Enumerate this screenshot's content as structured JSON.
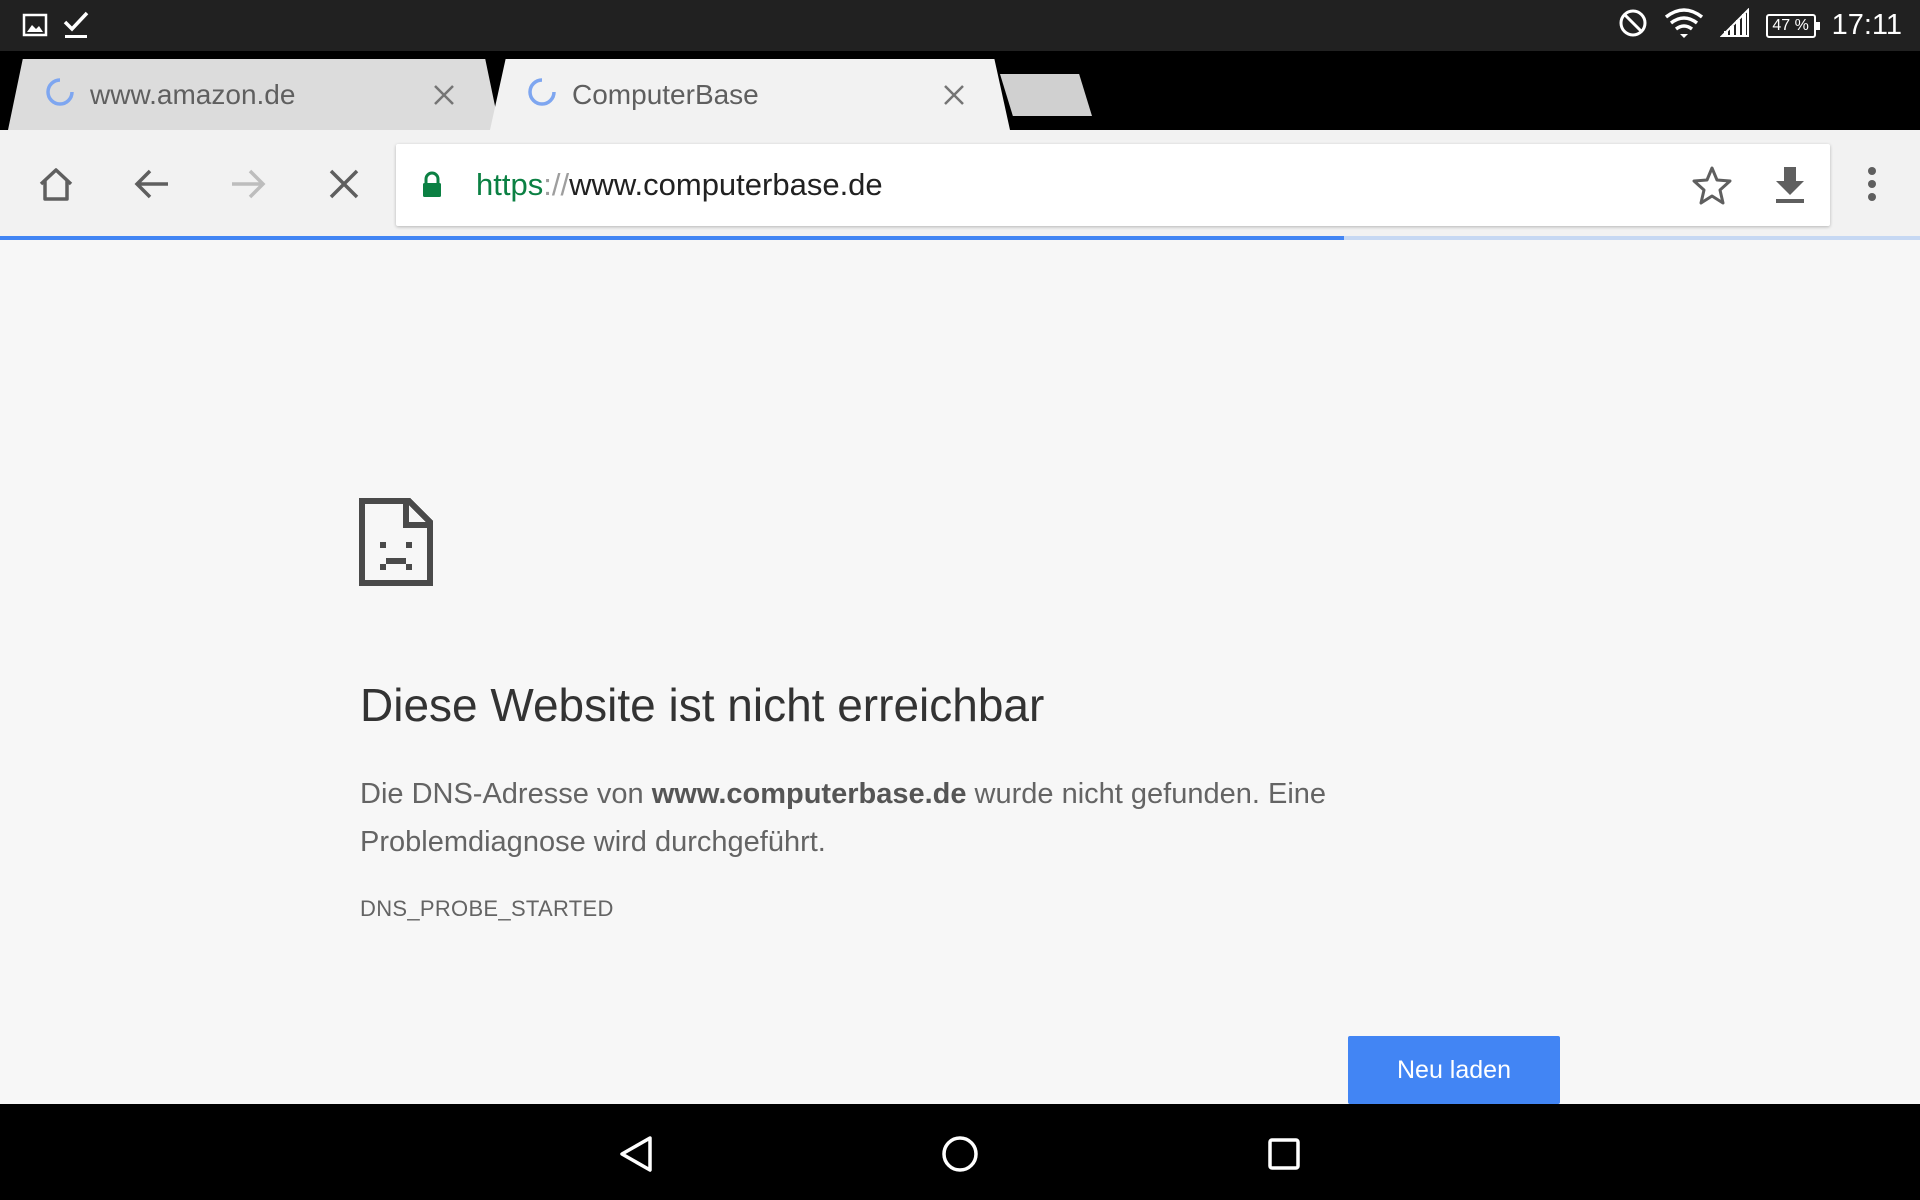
{
  "status_bar": {
    "time": "17:11",
    "battery": "47 %",
    "icons": [
      "image-icon",
      "check-icon",
      "do-not-disturb-icon",
      "wifi-icon",
      "signal-icon",
      "battery-icon"
    ]
  },
  "tabs": [
    {
      "title": "www.amazon.de",
      "state": "loading"
    },
    {
      "title": "ComputerBase",
      "state": "loading",
      "active": true
    }
  ],
  "toolbar": {
    "url_scheme": "https",
    "url_separator": "://",
    "url_host": "www.computerbase.de",
    "secure_color": "#0b8043",
    "page_load_progress": 0.7
  },
  "error_page": {
    "heading": "Diese Website ist nicht erreichbar",
    "message_prefix": "Die DNS-Adresse von ",
    "message_host": "www.computerbase.de",
    "message_suffix": " wurde nicht gefunden. Eine Problemdiagnose wird durchgeführt.",
    "error_code": "DNS_PROBE_STARTED",
    "reload_label": "Neu laden",
    "reload_color": "#4285f4"
  },
  "nav_bar": {
    "icons": [
      "back-triangle-icon",
      "home-circle-icon",
      "recents-square-icon"
    ]
  }
}
